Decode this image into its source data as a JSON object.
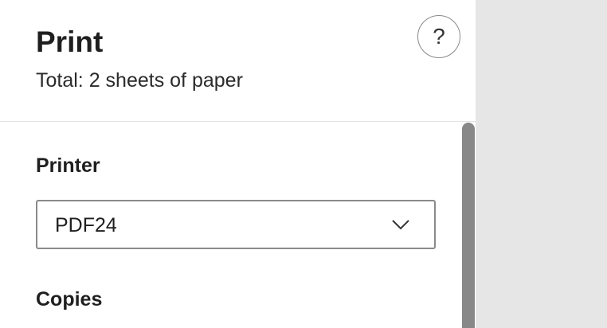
{
  "dialog": {
    "title": "Print",
    "total_sheets": "Total: 2 sheets of paper",
    "help_icon": "?"
  },
  "printer": {
    "label": "Printer",
    "selected": "PDF24",
    "dropdown_icon": "chevron-down-icon"
  },
  "copies": {
    "label": "Copies"
  },
  "colors": {
    "panel_bg": "#ffffff",
    "preview_bg": "#e6e6e6",
    "scrollbar_thumb": "#888888",
    "border": "#8a8a8a"
  }
}
